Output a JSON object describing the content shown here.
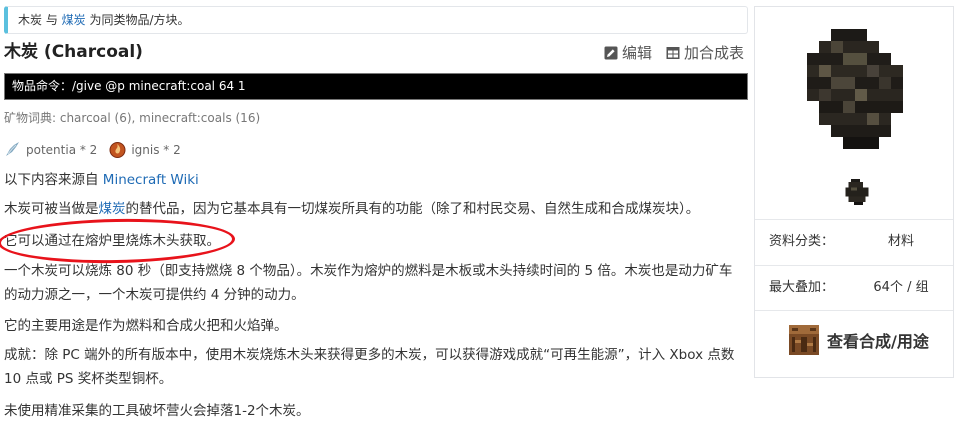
{
  "notice": {
    "prefix": "木炭 与 ",
    "link": "煤炭",
    "suffix": " 为同类物品/方块。"
  },
  "title": "木炭 (Charcoal)",
  "actions": {
    "edit": "编辑",
    "add_recipe": "加合成表"
  },
  "command": "物品命令：/give @p minecraft:coal 64 1",
  "ore_dict": "矿物词典: charcoal (6), minecraft:coals (16)",
  "aspects": [
    {
      "icon": "potentia-icon",
      "label": "potentia * 2"
    },
    {
      "icon": "ignis-icon",
      "label": "ignis * 2"
    }
  ],
  "source": {
    "prefix": "以下内容来源自 ",
    "link": "Minecraft Wiki"
  },
  "paragraphs": {
    "p1_a": "木炭可被当做是",
    "p1_link": "煤炭",
    "p1_b": "的替代品，因为它基本具有一切煤炭所具有的功能（除了和村民交易、自然生成和合成煤炭块）。",
    "p2": "它可以通过在熔炉里烧炼木头获取。",
    "p3": "一个木炭可以烧炼 80 秒（即支持燃烧 8 个物品）。木炭作为熔炉的燃料是木板或木头持续时间的 5 倍。木炭也是动力矿车的动力源之一，一个木炭可提供约 4 分钟的动力。",
    "p4": "它的主要用途是作为燃料和合成火把和火焰弹。",
    "p5": "成就：除 PC 端外的所有版本中，使用木炭烧炼木头来获得更多的木炭，可以获得游戏成就“可再生能源”，计入 Xbox 点数 10 点或 PS 奖杯类型铜杯。",
    "p6": "未使用精准采集的工具破坏营火会掉落1-2个木炭。"
  },
  "infobox": {
    "category_label": "资料分类：",
    "category_value": "材料",
    "stack_label": "最大叠加：",
    "stack_value": "64个 / 组",
    "recipe_button": "查看合成/用途"
  },
  "colors": {
    "link": "#1f6bb5",
    "highlight_circle": "#e8131b",
    "notice_accent": "#5bc0de"
  }
}
